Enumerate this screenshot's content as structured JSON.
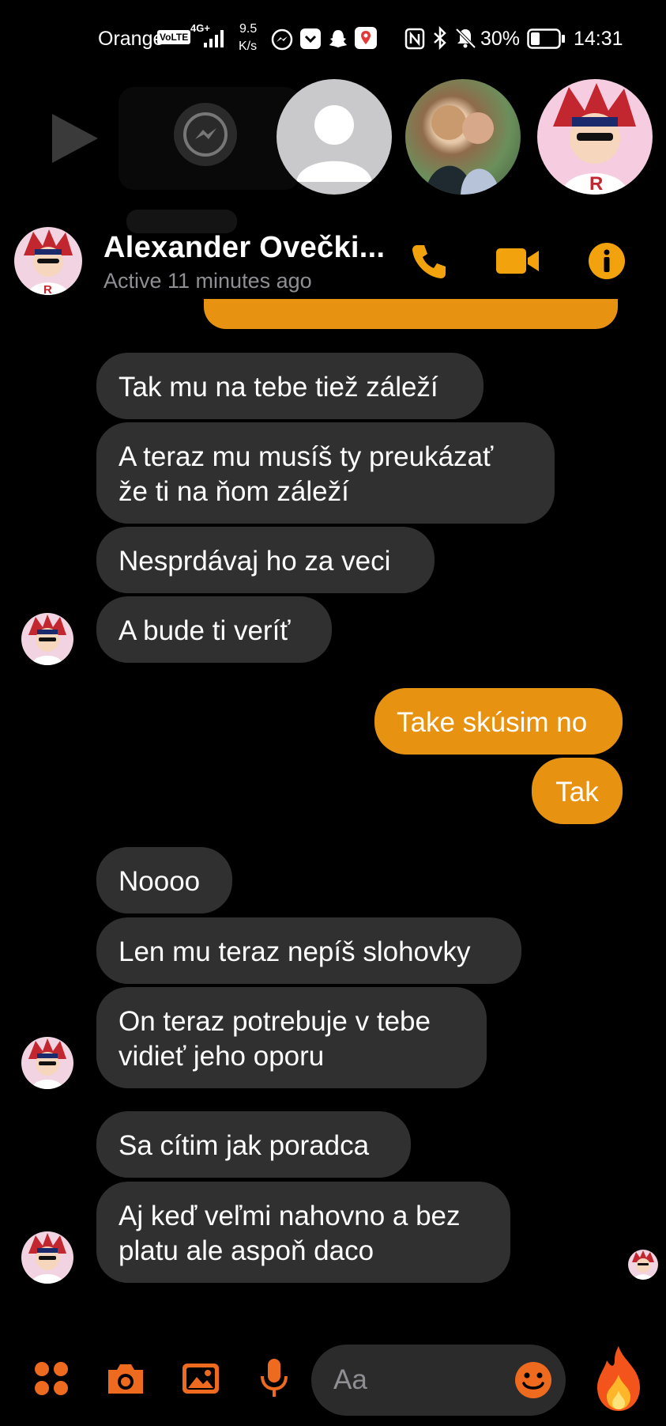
{
  "status_bar": {
    "carrier": "Orange",
    "volte": "VoLTE",
    "network": "4G+",
    "speed_value": "9.5",
    "speed_unit": "K/s",
    "battery": "30%",
    "time": "14:31"
  },
  "chat_heads": [
    {
      "name": "messenger-chathead",
      "icon": "messenger-icon"
    },
    {
      "name": "generic-user-chathead",
      "icon": "person-icon"
    },
    {
      "name": "family-photo-chathead",
      "icon": "photo-avatar"
    },
    {
      "name": "anime-avatar-chathead",
      "icon": "anime-avatar"
    }
  ],
  "header": {
    "contact_name": "Alexander Ovečki...",
    "status": "Active 11 minutes ago",
    "accent_color": "#f2a20c"
  },
  "messages": [
    {
      "dir": "in",
      "text": "Tak mu na tebe tiež záleží"
    },
    {
      "dir": "in",
      "text": "A teraz mu musíš ty preukázať\nže ti na ňom záleží"
    },
    {
      "dir": "in",
      "text": "Nesprdávaj ho za veci"
    },
    {
      "dir": "in",
      "text": "A bude ti veríť"
    },
    {
      "dir": "out",
      "text": "Take skúsim no"
    },
    {
      "dir": "out",
      "text": "Tak"
    },
    {
      "dir": "in",
      "text": "Noooo"
    },
    {
      "dir": "in",
      "text": "Len mu teraz nepíš slohovky"
    },
    {
      "dir": "in",
      "text": "On teraz potrebuje v tebe\nvidieť jeho oporu"
    },
    {
      "dir": "in",
      "text": "Sa cítim jak poradca"
    },
    {
      "dir": "in",
      "text": "Aj keď veľmi nahovno a bez\nplatu ale aspoň daco"
    }
  ],
  "composer": {
    "placeholder": "Aa"
  },
  "colors": {
    "incoming_bubble": "#303030",
    "outgoing_bubble": "#e89212",
    "background": "#000000"
  }
}
